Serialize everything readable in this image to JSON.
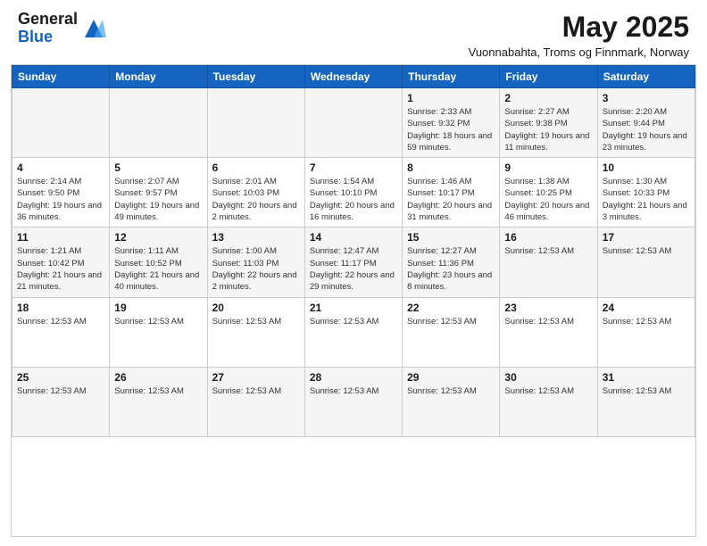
{
  "header": {
    "logo_general": "General",
    "logo_blue": "Blue",
    "month_title": "May 2025",
    "subtitle": "Vuonnabahta, Troms og Finnmark, Norway"
  },
  "weekdays": [
    "Sunday",
    "Monday",
    "Tuesday",
    "Wednesday",
    "Thursday",
    "Friday",
    "Saturday"
  ],
  "weeks": [
    [
      {
        "day": "",
        "info": ""
      },
      {
        "day": "",
        "info": ""
      },
      {
        "day": "",
        "info": ""
      },
      {
        "day": "",
        "info": ""
      },
      {
        "day": "1",
        "info": "Sunrise: 2:33 AM\nSunset: 9:32 PM\nDaylight: 18 hours\nand 59 minutes."
      },
      {
        "day": "2",
        "info": "Sunrise: 2:27 AM\nSunset: 9:38 PM\nDaylight: 19 hours\nand 11 minutes."
      },
      {
        "day": "3",
        "info": "Sunrise: 2:20 AM\nSunset: 9:44 PM\nDaylight: 19 hours\nand 23 minutes."
      }
    ],
    [
      {
        "day": "4",
        "info": "Sunrise: 2:14 AM\nSunset: 9:50 PM\nDaylight: 19 hours\nand 36 minutes."
      },
      {
        "day": "5",
        "info": "Sunrise: 2:07 AM\nSunset: 9:57 PM\nDaylight: 19 hours\nand 49 minutes."
      },
      {
        "day": "6",
        "info": "Sunrise: 2:01 AM\nSunset: 10:03 PM\nDaylight: 20 hours\nand 2 minutes."
      },
      {
        "day": "7",
        "info": "Sunrise: 1:54 AM\nSunset: 10:10 PM\nDaylight: 20 hours\nand 16 minutes."
      },
      {
        "day": "8",
        "info": "Sunrise: 1:46 AM\nSunset: 10:17 PM\nDaylight: 20 hours\nand 31 minutes."
      },
      {
        "day": "9",
        "info": "Sunrise: 1:38 AM\nSunset: 10:25 PM\nDaylight: 20 hours\nand 46 minutes."
      },
      {
        "day": "10",
        "info": "Sunrise: 1:30 AM\nSunset: 10:33 PM\nDaylight: 21 hours\nand 3 minutes."
      }
    ],
    [
      {
        "day": "11",
        "info": "Sunrise: 1:21 AM\nSunset: 10:42 PM\nDaylight: 21 hours\nand 21 minutes."
      },
      {
        "day": "12",
        "info": "Sunrise: 1:11 AM\nSunset: 10:52 PM\nDaylight: 21 hours\nand 40 minutes."
      },
      {
        "day": "13",
        "info": "Sunrise: 1:00 AM\nSunset: 11:03 PM\nDaylight: 22 hours\nand 2 minutes."
      },
      {
        "day": "14",
        "info": "Sunrise: 12:47 AM\nSunset: 11:17 PM\nDaylight: 22 hours\nand 29 minutes."
      },
      {
        "day": "15",
        "info": "Sunrise: 12:27 AM\nSunset: 11:36 PM\nDaylight: 23 hours\nand 8 minutes."
      },
      {
        "day": "16",
        "info": "Sunrise: 12:53 AM"
      },
      {
        "day": "17",
        "info": "Sunrise: 12:53 AM"
      }
    ],
    [
      {
        "day": "18",
        "info": "Sunrise: 12:53 AM"
      },
      {
        "day": "19",
        "info": "Sunrise: 12:53 AM"
      },
      {
        "day": "20",
        "info": "Sunrise: 12:53 AM"
      },
      {
        "day": "21",
        "info": "Sunrise: 12:53 AM"
      },
      {
        "day": "22",
        "info": "Sunrise: 12:53 AM"
      },
      {
        "day": "23",
        "info": "Sunrise: 12:53 AM"
      },
      {
        "day": "24",
        "info": "Sunrise: 12:53 AM"
      }
    ],
    [
      {
        "day": "25",
        "info": "Sunrise: 12:53 AM"
      },
      {
        "day": "26",
        "info": "Sunrise: 12:53 AM"
      },
      {
        "day": "27",
        "info": "Sunrise: 12:53 AM"
      },
      {
        "day": "28",
        "info": "Sunrise: 12:53 AM"
      },
      {
        "day": "29",
        "info": "Sunrise: 12:53 AM"
      },
      {
        "day": "30",
        "info": "Sunrise: 12:53 AM"
      },
      {
        "day": "31",
        "info": "Sunrise: 12:53 AM"
      }
    ]
  ]
}
